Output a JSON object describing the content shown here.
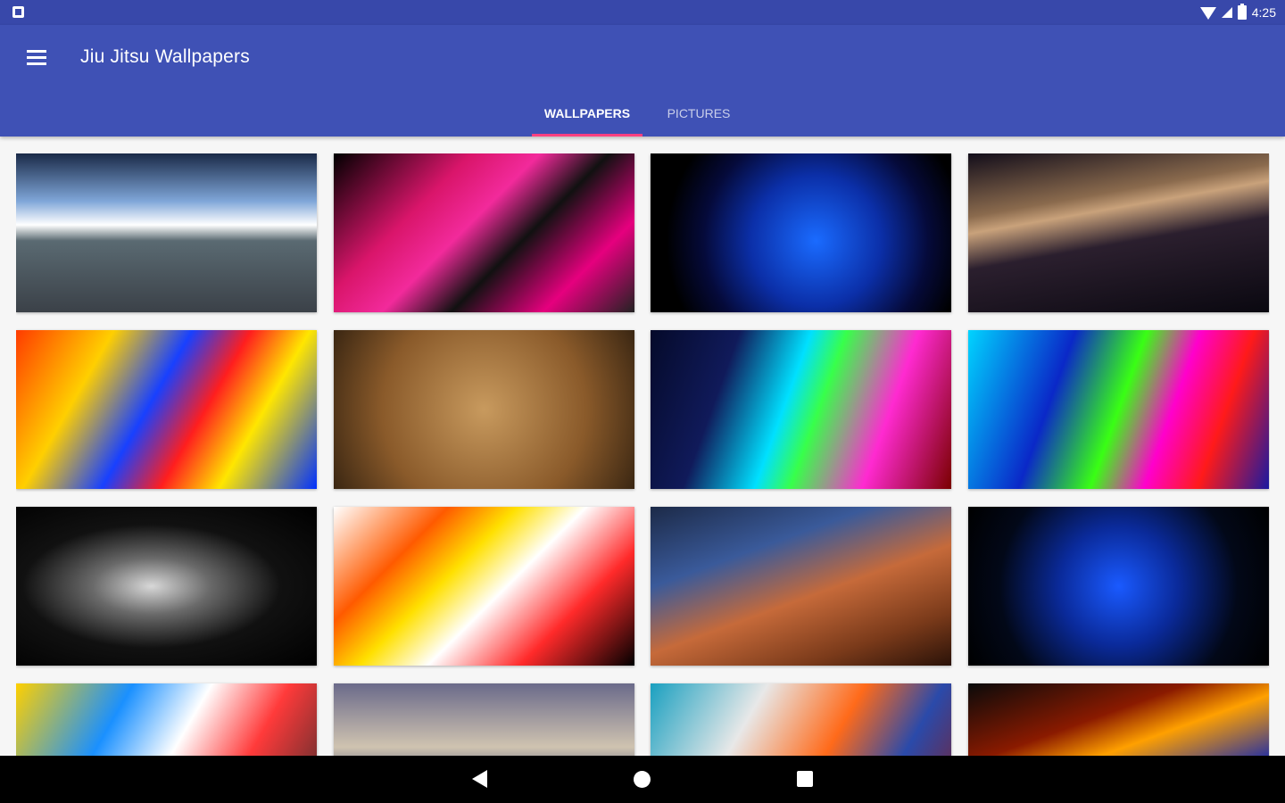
{
  "status_bar": {
    "time": "4:25",
    "left_icon": "notification-icon",
    "right_icons": [
      "wifi-icon",
      "signal-icon",
      "battery-icon"
    ]
  },
  "app_bar": {
    "title": "Jiu Jitsu Wallpapers",
    "menu_icon": "hamburger-menu-icon",
    "background_color": "#3f51b5",
    "tabs": [
      {
        "label": "WALLPAPERS",
        "selected": true
      },
      {
        "label": "PICTURES",
        "selected": false
      }
    ],
    "tab_indicator_color": "#ff4081"
  },
  "grid": {
    "tiles": [
      {
        "name": "wallpaper-tile-1",
        "bg": "linear-gradient(180deg,#1a2a48 0%,#7fa6d8 30%,#ffffff 45%,#5a6a72 55%,#3b4148 100%)"
      },
      {
        "name": "wallpaper-tile-2",
        "bg": "linear-gradient(135deg,#000 0%,#d9156a 30%,#f22a9b 45%,#111 60%,#e6007e 80%,#222 100%)"
      },
      {
        "name": "wallpaper-tile-3",
        "bg": "radial-gradient(circle at 55% 55%,#1a6bff 0%,#0b2fa8 35%,#050a3a 60%,#000 80%)"
      },
      {
        "name": "wallpaper-tile-4",
        "bg": "linear-gradient(170deg,#120d1a 0%,#8a6a4d 30%,#c9a27b 38%,#2b1f2e 55%,#0a0810 100%)"
      },
      {
        "name": "wallpaper-tile-5",
        "bg": "linear-gradient(120deg,#ff3b00 0%,#ffcf00 25%,#1840ff 45%,#ff1e1e 60%,#ffe600 75%,#0030ff 100%)"
      },
      {
        "name": "wallpaper-tile-6",
        "bg": "radial-gradient(circle at 50% 50%,#c89a5e 0%,#8a5a2a 60%,#3a2612 100%)"
      },
      {
        "name": "wallpaper-tile-7",
        "bg": "linear-gradient(110deg,#050a2a 0%,#101a5a 25%,#00e0ff 45%,#38ff4a 55%,#ff2ad1 75%,#7a0000 100%)"
      },
      {
        "name": "wallpaper-tile-8",
        "bg": "linear-gradient(110deg,#00d4ff 0%,#0a28c8 30%,#39ff14 50%,#ff00cc 65%,#ff1a1a 80%,#1a1aa0 100%)"
      },
      {
        "name": "wallpaper-tile-9",
        "bg": "radial-gradient(ellipse at 45% 50%,#d8d8d8 0%,#6a6a6a 25%,#111 55%,#000 100%)"
      },
      {
        "name": "wallpaper-tile-10",
        "bg": "linear-gradient(135deg,#fff 0%,#ff5a00 25%,#ffe000 40%,#fff 55%,#ff2a2a 75%,#000 100%)"
      },
      {
        "name": "wallpaper-tile-11",
        "bg": "linear-gradient(160deg,#1c2a48 0%,#3a5a9a 30%,#c66a3a 55%,#7a3a1a 80%,#2a1208 100%)"
      },
      {
        "name": "wallpaper-tile-12",
        "bg": "radial-gradient(circle at 50% 50%,#1a5aff 0%,#0a2a9a 35%,#020818 70%,#000 100%)"
      },
      {
        "name": "wallpaper-tile-13",
        "bg": "linear-gradient(120deg,#ffd000 0%,#1a90ff 30%,#fff 50%,#ff3a3a 70%,#2a2a2a 100%)"
      },
      {
        "name": "wallpaper-tile-14",
        "bg": "linear-gradient(180deg,#6a6a8a 0%,#cfc3b0 40%,#2a3a6a 70%,#1a1a2a 100%)"
      },
      {
        "name": "wallpaper-tile-15",
        "bg": "linear-gradient(120deg,#1aa0c0 0%,#e8e8e8 30%,#ff6a1a 55%,#2a4aaa 75%,#8a1a1a 100%)"
      },
      {
        "name": "wallpaper-tile-16",
        "bg": "linear-gradient(160deg,#0a0a0a 0%,#8a1a00 30%,#ffa000 45%,#1a2aaa 70%,#050a30 100%)"
      }
    ]
  },
  "nav_bar": {
    "icons": [
      "back-icon",
      "home-icon",
      "recents-icon"
    ]
  }
}
